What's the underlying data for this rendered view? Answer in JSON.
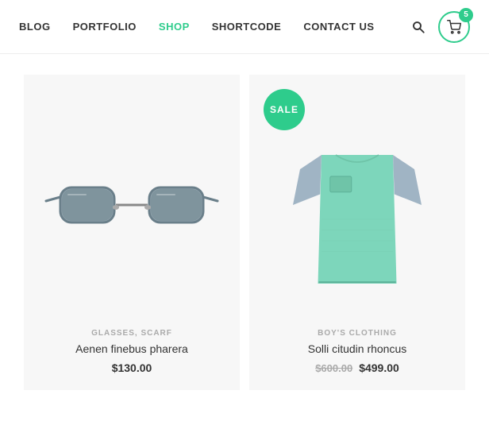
{
  "nav": {
    "links": [
      {
        "label": "BLOG",
        "active": false
      },
      {
        "label": "PORTFOLIO",
        "active": false
      },
      {
        "label": "SHOP",
        "active": true
      },
      {
        "label": "SHORTCODE",
        "active": false
      },
      {
        "label": "CONTACT US",
        "active": false
      }
    ],
    "cart_count": "5"
  },
  "products": [
    {
      "id": "product-glasses",
      "category": "GLASSES, SCARF",
      "name": "Aenen finebus pharera",
      "price": "$130.00",
      "original_price": null,
      "sale_price": null,
      "on_sale": false,
      "image_type": "sunglasses"
    },
    {
      "id": "product-tshirt",
      "category": "BOY'S CLOTHING",
      "name": "Solli citudin rhoncus",
      "price": null,
      "original_price": "$600.00",
      "sale_price": "$499.00",
      "on_sale": true,
      "image_type": "tshirt"
    }
  ],
  "sale_label": "SALE"
}
